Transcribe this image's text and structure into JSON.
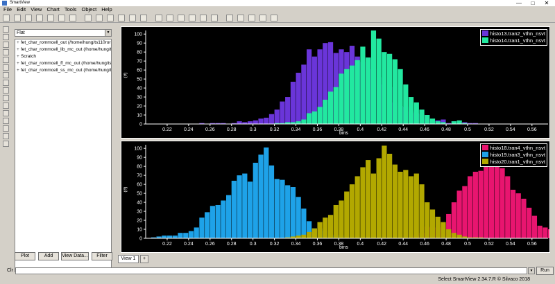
{
  "window": {
    "title": "SmartView",
    "min": "—",
    "max": "□",
    "close": "✕"
  },
  "menu": [
    "File",
    "Edit",
    "View",
    "Chart",
    "Tools",
    "Object",
    "Help"
  ],
  "left_panel": {
    "combo_value": "Flat",
    "tree": [
      "fet_char_rommcell_out (/home/hung/ts110ror",
      "fet_char_rommcell_lib_mc_out (/home/hung/t",
      "Scratch",
      "fet_char_rommcell_ff_mc_out (/home/hung/ts",
      "fet_char_rommcell_ss_mc_out (/home/hung/t"
    ],
    "buttons": [
      "Plot",
      "Add",
      "View Data...",
      "Filter"
    ]
  },
  "tabs": [
    "View 1",
    "+"
  ],
  "command": {
    "label": "Clr",
    "run": "Run",
    "value": ""
  },
  "status": "Select SmartView 2.34.7.R © Silvaco 2018",
  "colors": {
    "plot_bg": "#000000",
    "purple": "#6a35d9",
    "mint": "#22e8a0",
    "pink": "#e8156f",
    "blue": "#1ea2e8",
    "olive": "#b2a800"
  },
  "chart_data": [
    {
      "type": "bar",
      "xlabel": "bins",
      "ylabel": "(#)",
      "xlim": [
        0.2,
        0.575
      ],
      "ylim": [
        0,
        104
      ],
      "xticks": [
        "0.22",
        "0.24",
        "0.26",
        "0.28",
        "0.3",
        "0.32",
        "0.34",
        "0.36",
        "0.38",
        "0.4",
        "0.42",
        "0.44",
        "0.46",
        "0.48",
        "0.5",
        "0.52",
        "0.54",
        "0.56"
      ],
      "yticks": [
        "0",
        "10",
        "20",
        "30",
        "40",
        "50",
        "60",
        "70",
        "80",
        "90",
        "100"
      ],
      "legend_position": "top-right",
      "series": [
        {
          "name": "histo13.tran2_vthn_nsvt",
          "color": "#6a35d9",
          "x0": 0.25,
          "bin_width": 0.005,
          "values": [
            1,
            0,
            1,
            1,
            1,
            0,
            1,
            3,
            2,
            3,
            4,
            6,
            7,
            11,
            16,
            25,
            30,
            47,
            57,
            66,
            83,
            75,
            83,
            90,
            91,
            79,
            83,
            80,
            87,
            75,
            69,
            73,
            61,
            52,
            44,
            41,
            24,
            20,
            19,
            14,
            12,
            11,
            6,
            4,
            4,
            5,
            1,
            3,
            1,
            2,
            1,
            1
          ]
        },
        {
          "name": "histo14.tran1_vthn_nsvt",
          "color": "#22e8a0",
          "x0": 0.31,
          "bin_width": 0.005,
          "values": [
            0,
            0,
            1,
            1,
            2,
            2,
            3,
            5,
            12,
            14,
            19,
            27,
            36,
            41,
            56,
            61,
            65,
            71,
            86,
            74,
            104,
            95,
            80,
            78,
            72,
            61,
            44,
            30,
            24,
            16,
            10,
            6,
            3,
            2,
            0,
            3,
            4,
            1
          ]
        }
      ]
    },
    {
      "type": "bar",
      "xlabel": "bins",
      "ylabel": "(#)",
      "xlim": [
        0.2,
        0.575
      ],
      "ylim": [
        0,
        104
      ],
      "xticks": [
        "0.22",
        "0.24",
        "0.26",
        "0.28",
        "0.3",
        "0.32",
        "0.34",
        "0.36",
        "0.38",
        "0.4",
        "0.42",
        "0.44",
        "0.46",
        "0.48",
        "0.5",
        "0.52",
        "0.54",
        "0.56"
      ],
      "yticks": [
        "0",
        "10",
        "20",
        "30",
        "40",
        "50",
        "60",
        "70",
        "80",
        "90",
        "100"
      ],
      "legend_position": "top-right",
      "series": [
        {
          "name": "histo18.tran4_vthn_nsvt",
          "color": "#e8156f",
          "x0": 0.45,
          "bin_width": 0.005,
          "values": [
            3,
            6,
            13,
            12,
            12,
            16,
            27,
            40,
            53,
            58,
            69,
            74,
            75,
            85,
            99,
            97,
            78,
            69,
            54,
            50,
            44,
            34,
            25,
            14,
            12,
            10,
            7,
            6,
            5,
            4,
            2,
            1,
            0,
            1
          ]
        },
        {
          "name": "histo19.tran3_vthn_nsvt",
          "color": "#1ea2e8",
          "x0": 0.205,
          "bin_width": 0.005,
          "values": [
            1,
            2,
            3,
            3,
            3,
            6,
            6,
            8,
            12,
            23,
            29,
            36,
            37,
            42,
            48,
            64,
            70,
            72,
            63,
            84,
            93,
            101,
            81,
            66,
            65,
            59,
            57,
            46,
            33,
            19,
            11,
            11,
            8,
            2,
            4,
            3
          ]
        },
        {
          "name": "histo20.tran1_vthn_nsvt",
          "color": "#b2a800",
          "x0": 0.33,
          "bin_width": 0.005,
          "values": [
            1,
            2,
            3,
            4,
            7,
            11,
            18,
            23,
            26,
            37,
            42,
            52,
            60,
            69,
            79,
            87,
            72,
            89,
            103,
            94,
            82,
            74,
            76,
            69,
            72,
            60,
            40,
            32,
            24,
            18,
            10,
            6,
            4,
            2,
            1,
            1,
            1
          ]
        }
      ]
    }
  ]
}
